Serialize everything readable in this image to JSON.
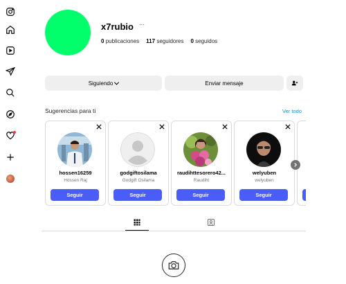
{
  "sidebar": {
    "items": [
      {
        "icon": "instagram-logo-icon"
      },
      {
        "icon": "home-icon"
      },
      {
        "icon": "reels-icon"
      },
      {
        "icon": "send-icon"
      },
      {
        "icon": "search-icon"
      },
      {
        "icon": "explore-icon"
      },
      {
        "icon": "heart-icon"
      },
      {
        "icon": "create-icon"
      },
      {
        "icon": "profile-avatar-icon"
      }
    ]
  },
  "profile": {
    "username": "x7rubio",
    "more": "···",
    "posts_count": "0",
    "posts_label": "publicaciones",
    "followers_count": "117",
    "followers_label": "seguidores",
    "following_count": "0",
    "following_label": "seguidos",
    "avatar_color": "#00ff6a"
  },
  "actions": {
    "following_label": "Siguiendo",
    "message_label": "Enviar mensaje"
  },
  "suggestions": {
    "title": "Sugerencias para ti",
    "see_all": "Ver todo",
    "follow_label": "Seguir",
    "cards": [
      {
        "username": "hossen16259",
        "name": "Hossen Raj"
      },
      {
        "username": "godgiftosilama",
        "name": "Godgift Osilama"
      },
      {
        "username": "raudihttesorero42...",
        "name": "Raudiht"
      },
      {
        "username": "welyuben",
        "name": "welyuben"
      }
    ]
  },
  "colors": {
    "accent": "#4a5df9",
    "link": "#0095f6",
    "button_bg": "#efefef"
  }
}
